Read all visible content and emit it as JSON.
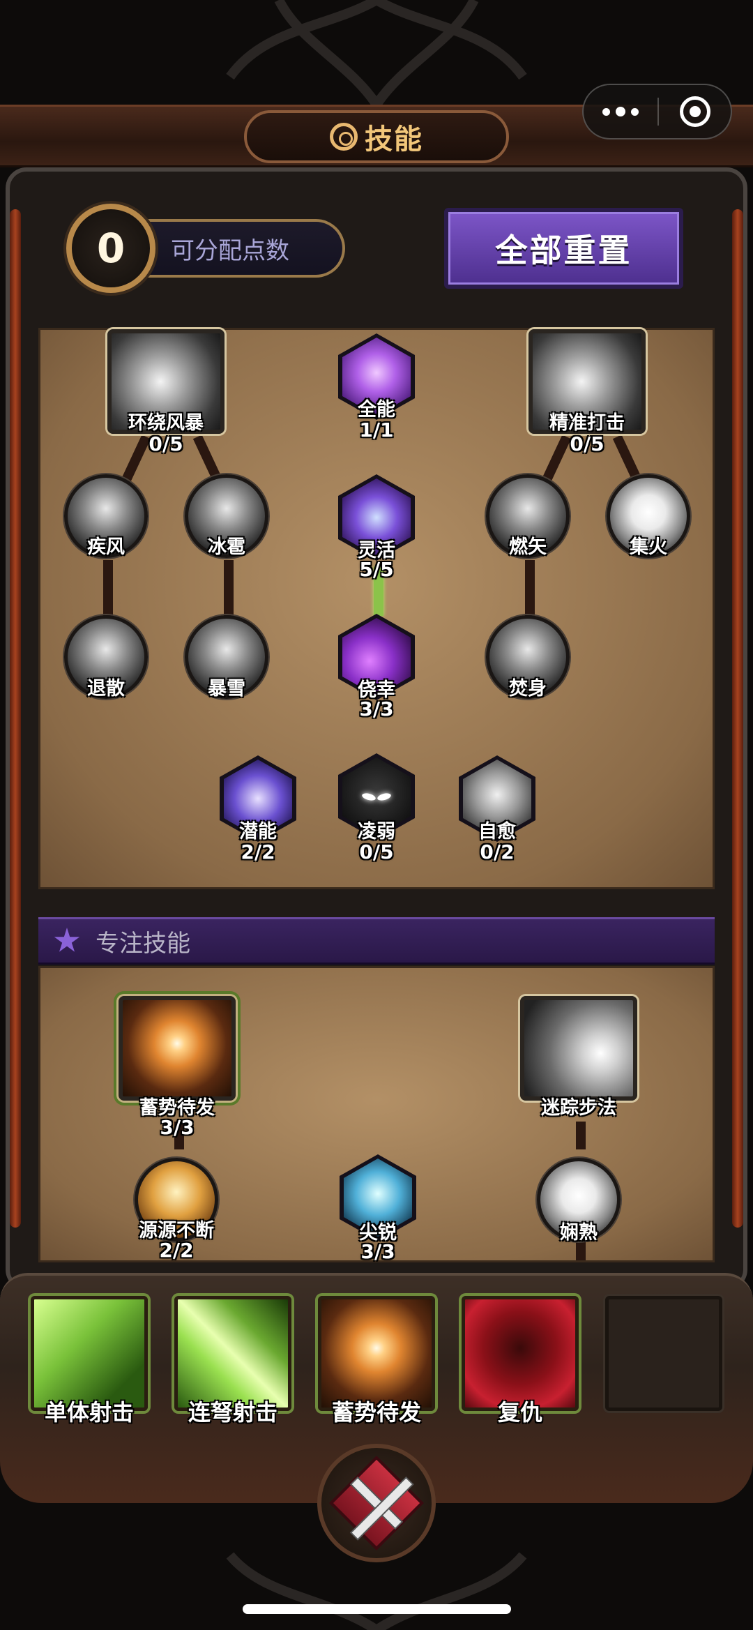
{
  "header": {
    "title": "技能",
    "icon": "skill-wheel-icon"
  },
  "capsule": {
    "more_icon": "more-dots-icon",
    "close_icon": "target-circle-icon"
  },
  "points": {
    "value": "0",
    "label": "可分配点数"
  },
  "reset_button": {
    "label": "全部重置"
  },
  "skill_tree": {
    "surround_storm": {
      "name": "环绕风暴",
      "level": "0/5"
    },
    "almighty": {
      "name": "全能",
      "level": "1/1"
    },
    "precise_strike": {
      "name": "精准打击",
      "level": "0/5"
    },
    "gale": {
      "name": "疾风"
    },
    "hail": {
      "name": "冰雹"
    },
    "agile": {
      "name": "灵活",
      "level": "5/5"
    },
    "burning_arrow": {
      "name": "燃矢"
    },
    "focus_fire": {
      "name": "集火"
    },
    "repel": {
      "name": "退散"
    },
    "blizzard": {
      "name": "暴雪"
    },
    "lucky": {
      "name": "侥幸",
      "level": "3/3"
    },
    "self_burn": {
      "name": "焚身"
    },
    "potential": {
      "name": "潜能",
      "level": "2/2"
    },
    "weaken": {
      "name": "凌弱",
      "level": "0/5"
    },
    "self_heal": {
      "name": "自愈",
      "level": "0/2"
    }
  },
  "focus_section": {
    "title": "专注技能"
  },
  "focus_tree": {
    "charge_up": {
      "name": "蓄势待发",
      "level": "3/3"
    },
    "phantom_step": {
      "name": "迷踪步法"
    },
    "endless_source": {
      "name": "源源不断",
      "level": "2/2"
    },
    "sharp": {
      "name": "尖锐",
      "level": "3/3"
    },
    "proficient": {
      "name": "娴熟"
    }
  },
  "equipped": [
    {
      "label": "单体射击"
    },
    {
      "label": "连弩射击"
    },
    {
      "label": "蓄势待发"
    },
    {
      "label": "复仇"
    },
    {
      "label": ""
    }
  ],
  "close_button": {
    "icon": "crossed-swords-close-icon"
  }
}
